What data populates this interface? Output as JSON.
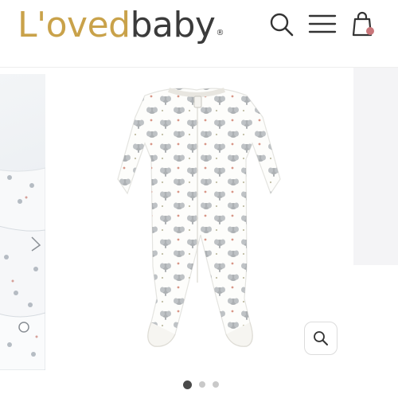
{
  "brand": {
    "name_part1": "L'oved",
    "name_part2": "baby",
    "registered_mark": "®",
    "color_primary": "#c9a24a",
    "color_secondary": "#3b3b3b"
  },
  "header": {
    "icons": [
      "search-icon",
      "menu-icon",
      "shopping-bag-icon"
    ],
    "cart_badge_color": "#c9767a"
  },
  "gallery": {
    "current_slide": 1,
    "total_slides": 3,
    "zoom_icon": "zoom-icon"
  }
}
